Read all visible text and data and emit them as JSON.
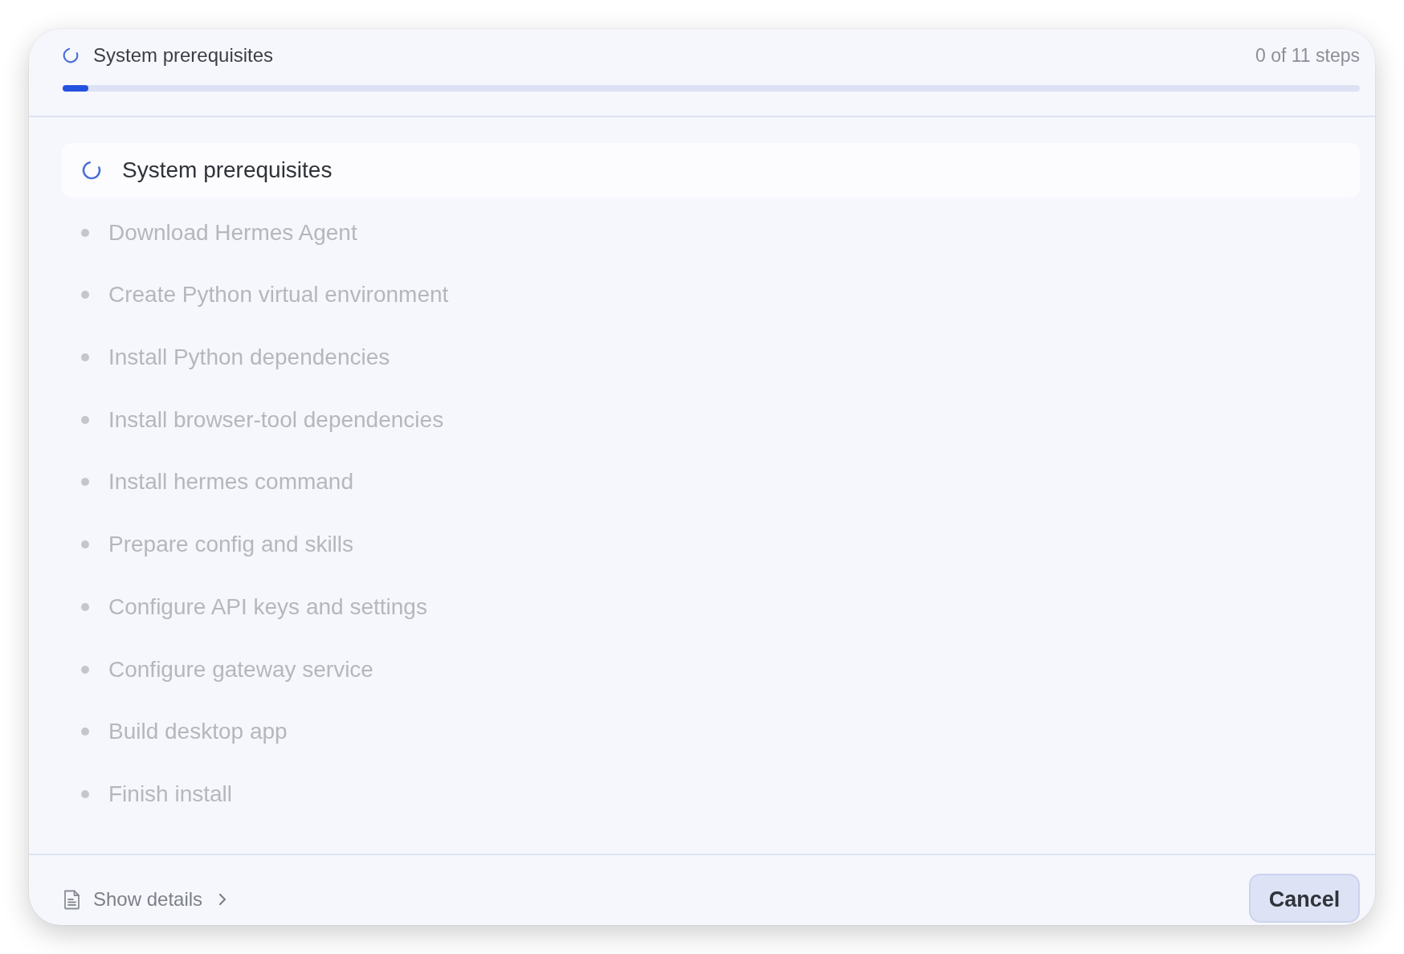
{
  "header": {
    "in_progress": true,
    "title": "System prerequisites",
    "counter": "0 of 11 steps",
    "progress": {
      "level": 0.02
    }
  },
  "steps": [
    {
      "label": "System prerequisites",
      "in_progress": true
    },
    {
      "label": "Download Hermes Agent",
      "in_progress": false
    },
    {
      "label": "Create Python virtual environment",
      "in_progress": false
    },
    {
      "label": "Install Python dependencies",
      "in_progress": false
    },
    {
      "label": "Install browser-tool dependencies",
      "in_progress": false
    },
    {
      "label": "Install hermes command",
      "in_progress": false
    },
    {
      "label": "Prepare config and skills",
      "in_progress": false
    },
    {
      "label": "Configure API keys and settings",
      "in_progress": false
    },
    {
      "label": "Configure gateway service",
      "in_progress": false
    },
    {
      "label": "Build desktop app",
      "in_progress": false
    },
    {
      "label": "Finish install",
      "in_progress": false
    }
  ],
  "footer": {
    "details_link": "Show details",
    "cancel_button": "Cancel"
  }
}
